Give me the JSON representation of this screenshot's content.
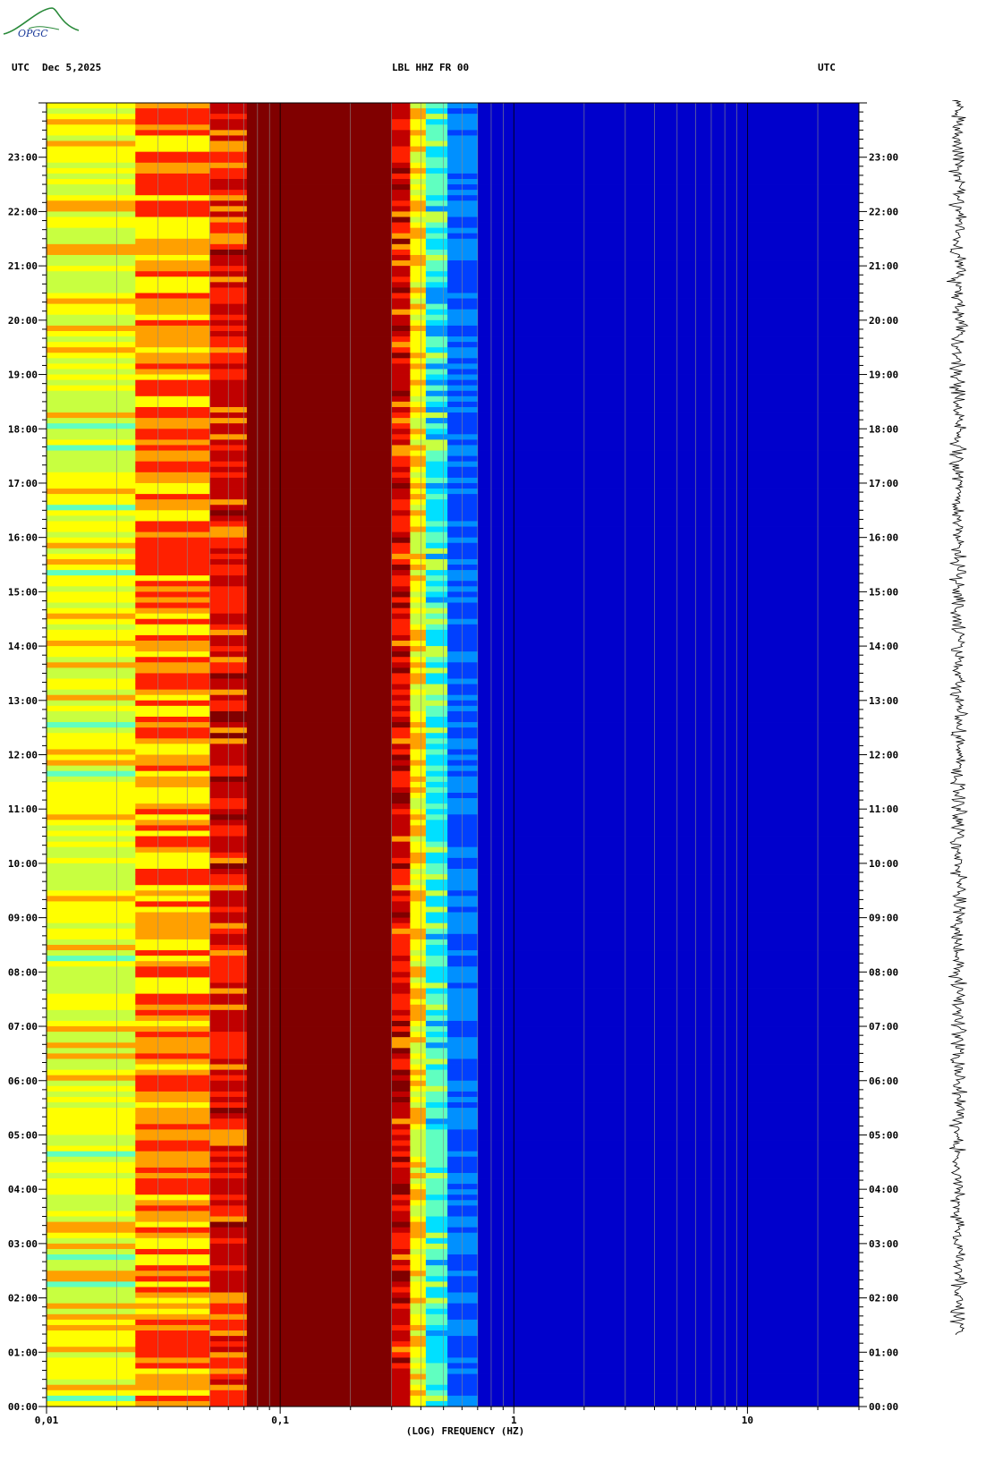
{
  "logo": {
    "text": "OPGC"
  },
  "header": {
    "left_tz": "UTC",
    "date": "Dec 5,2025",
    "station": "LBL HHZ FR 00",
    "right_tz": "UTC"
  },
  "chart_data": {
    "type": "heatmap",
    "title": "LBL HHZ FR 00",
    "xlabel": "(LOG) FREQUENCY (HZ)",
    "ylabel": "",
    "x_scale": "log",
    "xlim": [
      0.01,
      30
    ],
    "x_ticks": [
      {
        "value": 0.01,
        "label": "0,01"
      },
      {
        "value": 0.1,
        "label": "0,1"
      },
      {
        "value": 1,
        "label": "1"
      },
      {
        "value": 10,
        "label": "10"
      }
    ],
    "ylim_hours": [
      0,
      24
    ],
    "y_ticks": [
      "00:00",
      "01:00",
      "02:00",
      "03:00",
      "04:00",
      "05:00",
      "06:00",
      "07:00",
      "08:00",
      "09:00",
      "10:00",
      "11:00",
      "12:00",
      "13:00",
      "14:00",
      "15:00",
      "16:00",
      "17:00",
      "18:00",
      "19:00",
      "20:00",
      "21:00",
      "22:00",
      "23:00"
    ],
    "colormap": [
      "#00007a",
      "#0000cc",
      "#0040ff",
      "#0090ff",
      "#00e0ff",
      "#60ffc0",
      "#c8ff40",
      "#ffff00",
      "#ffa000",
      "#ff2000",
      "#c00000",
      "#800000"
    ],
    "bands_hz_level": [
      {
        "f_from": 0.01,
        "f_to": 0.024,
        "level": 6.5
      },
      {
        "f_from": 0.024,
        "f_to": 0.05,
        "level": 8.0
      },
      {
        "f_from": 0.05,
        "f_to": 0.072,
        "level": 9.2
      },
      {
        "f_from": 0.072,
        "f_to": 0.3,
        "level": 11
      },
      {
        "f_from": 0.3,
        "f_to": 0.36,
        "level": 9.5
      },
      {
        "f_from": 0.36,
        "f_to": 0.42,
        "level": 7.0
      },
      {
        "f_from": 0.42,
        "f_to": 0.52,
        "level": 4.5
      },
      {
        "f_from": 0.52,
        "f_to": 0.7,
        "level": 2.5
      },
      {
        "f_from": 0.7,
        "f_to": 30,
        "level": 1.0
      }
    ]
  }
}
